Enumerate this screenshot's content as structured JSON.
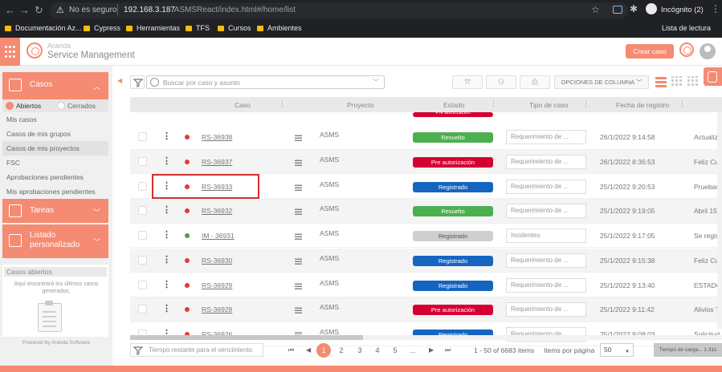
{
  "browser": {
    "not_secure_label": "No es seguro",
    "url_host": "192.168.3.187",
    "url_path": "/ASMSReact/index.html#/home/list",
    "incognito_label": "Incógnito (2)",
    "bookmarks": [
      "Documentación Az...",
      "Cypress",
      "Herramientas",
      "TFS",
      "Cursos",
      "Ambientes"
    ],
    "reading_list": "Lista de lectura"
  },
  "app": {
    "brand_top": "Aranda",
    "brand_main": "Service Management",
    "create_button": "Crear caso",
    "accent_color": "#f48b72"
  },
  "sidebar": {
    "casos_label": "Casos",
    "tab_open": "Abiertos",
    "tab_closed": "Cerrados",
    "items": [
      "Mis casos",
      "Casos de mis grupos",
      "Casos de mis proyectos",
      "FSC",
      "Aprobaciones pendientes",
      "Mis aprobaciones pendientes"
    ],
    "active_item": "Casos de mis proyectos",
    "tareas_label": "Tareas",
    "listado_label": "Listado personalizado",
    "open_cases_title": "Casos abiertos",
    "open_cases_msg": "Aquí encontrará los últimos casos generados.",
    "powered_by": "Powered by Aranda Software"
  },
  "toolbar": {
    "search_placeholder": "Buscar por caso y asunto",
    "column_options": "OPCIONES DE COLUMNA"
  },
  "table": {
    "columns": {
      "caso": "Caso",
      "proyecto": "Proyecto",
      "estado": "Estado",
      "tipo": "Tipo de caso",
      "fecha": "Fecha de registro"
    },
    "partial_top": {
      "estado": "Pre autorización",
      "estado_color": "#d50032"
    },
    "rows": [
      {
        "caso": "RS-36938",
        "proyecto": "ASMS",
        "estado": "Resuelto",
        "estado_color": "#4caf50",
        "tipo": "Requerimiento de ...",
        "fecha": "26/1/2022 9:14:58",
        "extra": "Actualizac",
        "dot": "red"
      },
      {
        "caso": "RS-36937",
        "proyecto": "ASMS",
        "estado": "Pre autorización",
        "estado_color": "#d50032",
        "tipo": "Requerimiento de ...",
        "fecha": "26/1/2022 8:36:53",
        "extra": "Feliz Cum",
        "dot": "red"
      },
      {
        "caso": "RS-36933",
        "proyecto": "ASMS",
        "estado": "Registrado",
        "estado_color": "#1565c0",
        "tipo": "Requerimiento de ...",
        "fecha": "25/1/2022 9:20:53",
        "extra": "Pruebas g",
        "dot": "red"
      },
      {
        "caso": "RS-36932",
        "proyecto": "ASMS",
        "estado": "Resuelto",
        "estado_color": "#4caf50",
        "tipo": "Requerimiento de ...",
        "fecha": "25/1/2022 9:19:05",
        "extra": "Abril 15 H",
        "dot": "red"
      },
      {
        "caso": "IM - 36931",
        "proyecto": "ASMS",
        "estado": "Registrado",
        "estado_color": "#cfcfcf",
        "tipo": "Incidentes",
        "fecha": "25/1/2022 9:17:05",
        "extra": "Se registr",
        "dot": "green"
      },
      {
        "caso": "RS-36930",
        "proyecto": "ASMS",
        "estado": "Registrado",
        "estado_color": "#1565c0",
        "tipo": "Requerimiento de ...",
        "fecha": "25/1/2022 9:15:38",
        "extra": "Feliz Cum",
        "dot": "red"
      },
      {
        "caso": "RS-36929",
        "proyecto": "ASMS",
        "estado": "Registrado",
        "estado_color": "#1565c0",
        "tipo": "Requerimiento de ...",
        "fecha": "25/1/2022 9:13:40",
        "extra": "ESTADO D",
        "dot": "red"
      },
      {
        "caso": "RS-36928",
        "proyecto": "ASMS",
        "estado": "Pre autorización",
        "estado_color": "#d50032",
        "tipo": "Requerimiento de ...",
        "fecha": "25/1/2022 9:11:42",
        "extra": "Alivios Tril",
        "dot": "red"
      },
      {
        "caso": "RS-36926",
        "proyecto": "ASMS",
        "estado": "Registrado",
        "estado_color": "#1565c0",
        "tipo": "Requerimiento de ...",
        "fecha": "25/1/2022 9:08:03",
        "extra": "Solicitud",
        "dot": "red"
      }
    ]
  },
  "footer": {
    "time_filter_placeholder": "Tiempo restante para el vencimiento",
    "pages": [
      "1",
      "2",
      "3",
      "4",
      "5",
      "..."
    ],
    "range": "1 - 50 of 6683 items",
    "items_per_page_label": "Items por página",
    "items_per_page": "50",
    "load_time": "Tiempo de carga... 1.31s"
  }
}
